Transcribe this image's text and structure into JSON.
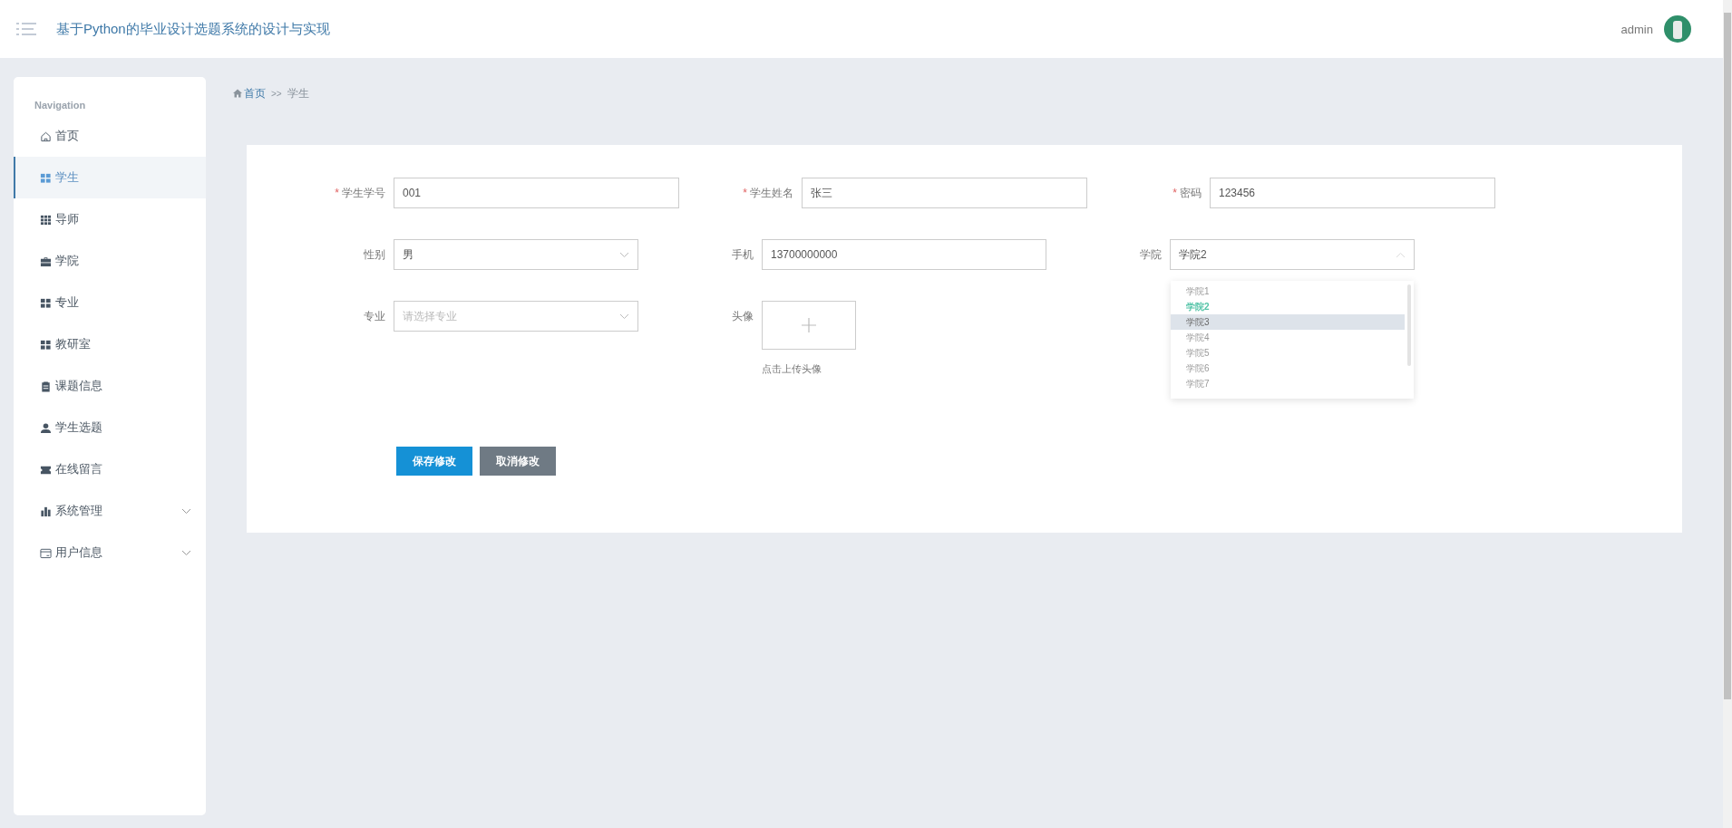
{
  "header": {
    "title": "基于Python的毕业设计选题系统的设计与实现",
    "user": "admin"
  },
  "sidebar": {
    "heading": "Navigation",
    "items": [
      {
        "label": "首页",
        "kind": "home",
        "selected": false
      },
      {
        "label": "学生",
        "kind": "grid",
        "selected": true
      },
      {
        "label": "导师",
        "kind": "grid9",
        "selected": false
      },
      {
        "label": "学院",
        "kind": "briefcase",
        "selected": false
      },
      {
        "label": "专业",
        "kind": "grid",
        "selected": false
      },
      {
        "label": "教研室",
        "kind": "grid",
        "selected": false
      },
      {
        "label": "课题信息",
        "kind": "clipboard",
        "selected": false
      },
      {
        "label": "学生选题",
        "kind": "user",
        "selected": false
      },
      {
        "label": "在线留言",
        "kind": "ticket",
        "selected": false
      },
      {
        "label": "系统管理",
        "kind": "bars",
        "selected": false,
        "expanded": false
      },
      {
        "label": "用户信息",
        "kind": "card",
        "selected": false,
        "expanded": false
      }
    ]
  },
  "breadcrumb": {
    "home": "首页",
    "separator": ">>",
    "current": "学生"
  },
  "form": {
    "rows": [
      [
        {
          "label": "学生学号",
          "required_mark": "*",
          "kind": "text",
          "value": "001"
        },
        {
          "label": "学生姓名",
          "required_mark": "*",
          "kind": "text",
          "value": "张三"
        },
        {
          "label": "密码",
          "required_mark": "*",
          "kind": "text",
          "value": "123456"
        }
      ],
      [
        {
          "label": "性别",
          "kind": "select",
          "value": "男",
          "open": false
        },
        {
          "label": "手机",
          "kind": "text",
          "value": "13700000000"
        },
        {
          "label": "学院",
          "kind": "select",
          "value": "学院2",
          "open": true,
          "options": [
            {
              "label": "学院1",
              "selected": false,
              "hovered": false
            },
            {
              "label": "学院2",
              "selected": true,
              "hovered": false
            },
            {
              "label": "学院3",
              "selected": false,
              "hovered": true
            },
            {
              "label": "学院4",
              "selected": false,
              "hovered": false
            },
            {
              "label": "学院5",
              "selected": false,
              "hovered": false
            },
            {
              "label": "学院6",
              "selected": false,
              "hovered": false
            },
            {
              "label": "学院7",
              "selected": false,
              "hovered": false
            }
          ]
        }
      ],
      [
        {
          "label": "专业",
          "kind": "select",
          "placeholder": "请选择专业",
          "open": false
        },
        {
          "label": "头像",
          "kind": "upload",
          "hint": "点击上传头像"
        }
      ]
    ],
    "buttons": [
      {
        "label": "保存修改",
        "kind": "primary"
      },
      {
        "label": "取消修改",
        "kind": "secondary"
      }
    ]
  }
}
